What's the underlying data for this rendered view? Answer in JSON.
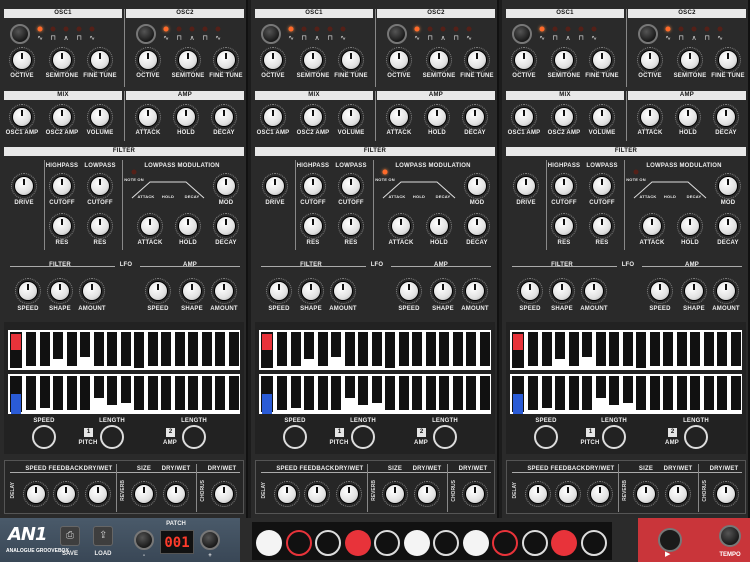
{
  "osc": {
    "osc1": "OSC1",
    "osc2": "OSC2",
    "octave": "OCTIVE",
    "semitone": "SEMITONE",
    "fine_tune": "FINE TUNE"
  },
  "mix": {
    "title": "MIX",
    "osc1_amp": "OSC1 AMP",
    "osc2_amp": "OSC2 AMP",
    "volume": "VOLUME"
  },
  "amp": {
    "title": "AMP",
    "attack": "ATTACK",
    "hold": "HOLD",
    "decay": "DECAY"
  },
  "filter": {
    "title": "FILTER",
    "drive": "DRIVE",
    "highpass": "HIGHPASS",
    "lowpass": "LOWPASS",
    "lowpass_modulation": "LOWPASS MODULATION",
    "cutoff": "CUTOFF",
    "res": "RES",
    "mod": "MOD",
    "attack": "ATTACK",
    "hold": "HOLD",
    "decay": "DECAY",
    "env_attack": "ATTACK",
    "env_hold": "HOLD",
    "env_decay": "DECAY",
    "note_on": "NOTE ON"
  },
  "lfo": {
    "title": "LFO",
    "filter": "FILTER",
    "amp": "AMP",
    "speed": "SPEED",
    "shape": "SHAPE",
    "amount": "AMOUNT"
  },
  "seq": {
    "speed": "SPEED",
    "length": "LENGTH",
    "pitch": "PITCH",
    "amp": "AMP",
    "badge1": "1",
    "badge2": "2"
  },
  "fx": {
    "speed": "SPEED",
    "feedback": "FEEDBACK",
    "dry_wet": "DRY/WET",
    "size": "SIZE",
    "delay": "DELAY",
    "reverb": "REVERB",
    "chorus": "CHORUS"
  },
  "bottom": {
    "logo": "AN1",
    "logo_sub": "ANALOGUE GROOVEBOX",
    "save": "SAVE",
    "load": "LOAD",
    "patch_label": "PATCH",
    "patch_value": "001",
    "minus": "-",
    "plus": "+",
    "tempo": "TEMPO",
    "pads": [
      "white",
      "red-outline",
      "black",
      "red",
      "black",
      "white",
      "black",
      "white",
      "red-outline",
      "black",
      "red",
      "black"
    ]
  },
  "colors": {
    "accent_red": "#e8333a",
    "accent_blue": "#2a5bd6",
    "led_on": "#ff6a2a"
  }
}
